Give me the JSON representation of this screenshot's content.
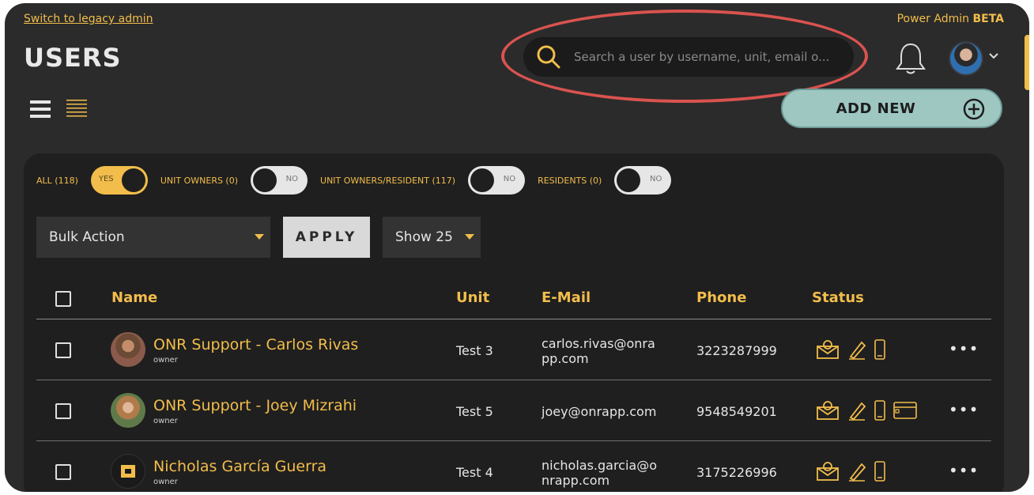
{
  "header": {
    "legacy_link": "Switch to legacy admin",
    "power_admin": "Power Admin",
    "beta": "BETA",
    "title": "USERS"
  },
  "search": {
    "placeholder": "Search a user by username, unit, email o..."
  },
  "add_new": {
    "label": "ADD NEW"
  },
  "filters": [
    {
      "label": "ALL (118)",
      "toggle": "YES",
      "on": true
    },
    {
      "label": "UNIT OWNERS (0)",
      "toggle": "NO",
      "on": false
    },
    {
      "label": "UNIT OWNERS/RESIDENT (117)",
      "toggle": "NO",
      "on": false
    },
    {
      "label": "RESIDENTS (0)",
      "toggle": "NO",
      "on": false
    }
  ],
  "controls": {
    "bulk_action": "Bulk Action",
    "apply": "APPLY",
    "show": "Show 25"
  },
  "table": {
    "columns": [
      "Name",
      "Unit",
      "E-Mail",
      "Phone",
      "Status"
    ],
    "rows": [
      {
        "name": "ONR Support -  Carlos Rivas",
        "role": "owner",
        "unit": "Test 3",
        "email": "carlos.rivas@onrapp.com",
        "email_l1": "carlos.rivas@onra",
        "email_l2": "pp.com",
        "phone": "3223287999"
      },
      {
        "name": "ONR Support -  Joey Mizrahi",
        "role": "owner",
        "unit": "Test 5",
        "email": "joey@onrapp.com",
        "phone": "9548549201"
      },
      {
        "name": "Nicholas García Guerra",
        "role": "owner",
        "unit": "Test 4",
        "email": "nicholas.garcia@onrapp.com",
        "email_l1": "nicholas.garcia@o",
        "email_l2": "nrapp.com",
        "phone": "3175226996"
      }
    ]
  },
  "colors": {
    "accent": "#f2bd4b",
    "background": "#2b2b2b",
    "panel": "#1f1f1f",
    "add_new": "#9ec7c2",
    "highlight": "#d9534f"
  },
  "icons": [
    "search-icon",
    "bell-icon",
    "chevron-down-icon",
    "list-view-icon",
    "compact-list-icon",
    "plus-circle-icon",
    "email-status-icon",
    "signature-status-icon",
    "mobile-status-icon",
    "card-status-icon",
    "more-icon"
  ]
}
